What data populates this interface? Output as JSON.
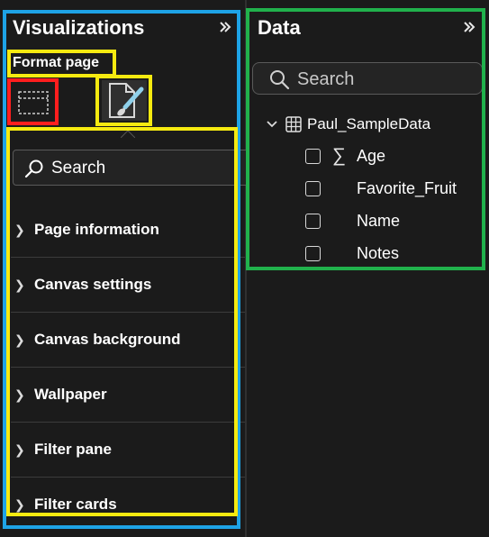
{
  "visualizations": {
    "title": "Visualizations",
    "format_label": "Format page",
    "search_placeholder": "Search",
    "sections": [
      {
        "label": "Page information"
      },
      {
        "label": "Canvas settings"
      },
      {
        "label": "Canvas background"
      },
      {
        "label": "Wallpaper"
      },
      {
        "label": "Filter pane"
      },
      {
        "label": "Filter cards"
      }
    ]
  },
  "data": {
    "title": "Data",
    "search_placeholder": "Search",
    "table": {
      "name": "Paul_SampleData",
      "fields": [
        {
          "name": "Age",
          "icon": "sigma-icon"
        },
        {
          "name": "Favorite_Fruit"
        },
        {
          "name": "Name"
        },
        {
          "name": "Notes"
        }
      ]
    }
  },
  "colors": {
    "highlight_blue": "#1ea3e6",
    "highlight_green": "#21b14c",
    "highlight_yellow": "#f6ea10",
    "highlight_red": "#ff1e1e",
    "pane_background": "#1b1b1b"
  }
}
